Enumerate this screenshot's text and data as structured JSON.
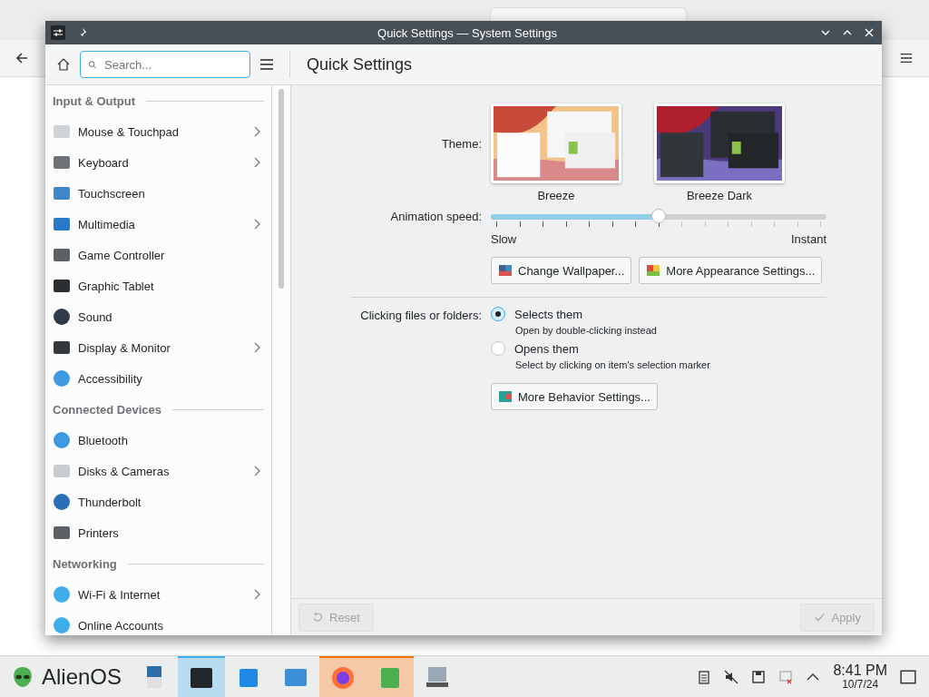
{
  "window": {
    "title": "Quick Settings — System Settings"
  },
  "search": {
    "placeholder": "Search..."
  },
  "page_title": "Quick Settings",
  "sidebar": {
    "groups": [
      {
        "title": "Input & Output",
        "items": [
          {
            "label": "Mouse & Touchpad",
            "has_submenu": true
          },
          {
            "label": "Keyboard",
            "has_submenu": true
          },
          {
            "label": "Touchscreen",
            "has_submenu": false
          },
          {
            "label": "Multimedia",
            "has_submenu": true
          },
          {
            "label": "Game Controller",
            "has_submenu": false
          },
          {
            "label": "Graphic Tablet",
            "has_submenu": false
          },
          {
            "label": "Sound",
            "has_submenu": false
          },
          {
            "label": "Display & Monitor",
            "has_submenu": true
          },
          {
            "label": "Accessibility",
            "has_submenu": false
          }
        ]
      },
      {
        "title": "Connected Devices",
        "items": [
          {
            "label": "Bluetooth",
            "has_submenu": false
          },
          {
            "label": "Disks & Cameras",
            "has_submenu": true
          },
          {
            "label": "Thunderbolt",
            "has_submenu": false
          },
          {
            "label": "Printers",
            "has_submenu": false
          }
        ]
      },
      {
        "title": "Networking",
        "items": [
          {
            "label": "Wi-Fi & Internet",
            "has_submenu": true
          },
          {
            "label": "Online Accounts",
            "has_submenu": false
          }
        ]
      }
    ]
  },
  "theme": {
    "label": "Theme:",
    "options": [
      {
        "name": "Breeze",
        "kind": "light"
      },
      {
        "name": "Breeze Dark",
        "kind": "dark"
      }
    ]
  },
  "animation": {
    "label": "Animation speed:",
    "level": 0.5,
    "min_label": "Slow",
    "max_label": "Instant"
  },
  "appearance_buttons": [
    "Change Wallpaper...",
    "More Appearance Settings..."
  ],
  "clicking": {
    "label": "Clicking files or folders:",
    "options": [
      {
        "label": "Selects them",
        "hint": "Open by double-clicking instead",
        "selected": true
      },
      {
        "label": "Opens them",
        "hint": "Select by clicking on item's selection marker",
        "selected": false
      }
    ]
  },
  "behavior_button": "More Behavior Settings...",
  "footer": {
    "reset": {
      "label": "Reset",
      "disabled": true
    },
    "apply": {
      "label": "Apply",
      "disabled": true
    }
  },
  "taskbar": {
    "start_label": "AlienOS",
    "tasks": [
      {
        "selected": false,
        "attention": false
      },
      {
        "selected": true,
        "attention": false
      },
      {
        "selected": false,
        "attention": false
      },
      {
        "selected": false,
        "attention": false
      },
      {
        "selected": false,
        "attention": true
      },
      {
        "selected": false,
        "attention": true
      },
      {
        "selected": false,
        "attention": false
      }
    ],
    "time": "8:41 PM",
    "date": "10/7/24"
  }
}
